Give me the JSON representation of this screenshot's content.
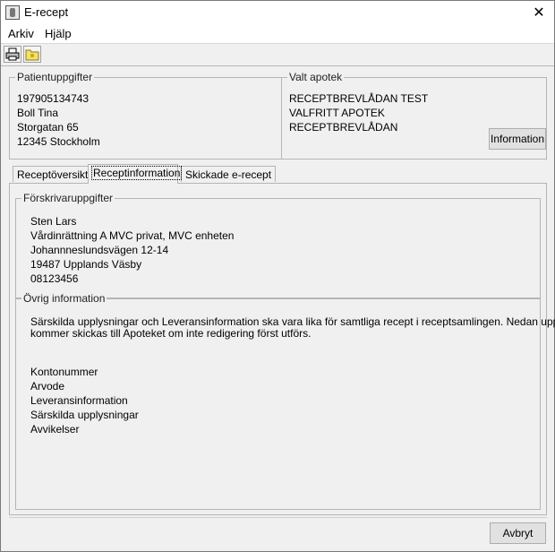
{
  "window": {
    "title": "E-recept"
  },
  "menu": {
    "file": "Arkiv",
    "help": "Hjälp"
  },
  "patient": {
    "legend": "Patientuppgifter",
    "id": "197905134743",
    "name": "Boll Tina",
    "street": "Storgatan 65",
    "city": "12345 Stockholm"
  },
  "pharmacy": {
    "legend": "Valt apotek",
    "line1": "RECEPTBREVLÅDAN TEST",
    "line2": "VALFRITT APOTEK",
    "line3": "RECEPTBREVLÅDAN",
    "info_button": "Information"
  },
  "tabs": [
    {
      "label": "Receptöversikt"
    },
    {
      "label": "Receptinformation"
    },
    {
      "label": "Skickade e-recept"
    }
  ],
  "prescriber": {
    "legend": "Förskrivaruppgifter",
    "name": "Sten Lars",
    "unit": "Vårdinrättning A MVC privat, MVC enheten",
    "street": "Johannneslundsvägen 12-14",
    "city": "19487 Upplands Väsby",
    "phone": "08123456"
  },
  "other": {
    "legend": "Övrig information",
    "note_line1": "Särskilda upplysningar och Leveransinformation ska vara lika för samtliga recept i receptsamlingen. Nedan uppgifter",
    "note_line2": "kommer skickas till Apoteket om inte redigering först utförs.",
    "fields": [
      "Kontonummer",
      "Arvode",
      "Leveransinformation",
      "Särskilda upplysningar",
      "Avvikelser"
    ]
  },
  "footer": {
    "cancel_button": "Avbryt"
  },
  "icons": {
    "toolbar": [
      "printer-icon",
      "folder-icon"
    ],
    "title": "app-icon",
    "close": "close-icon"
  }
}
